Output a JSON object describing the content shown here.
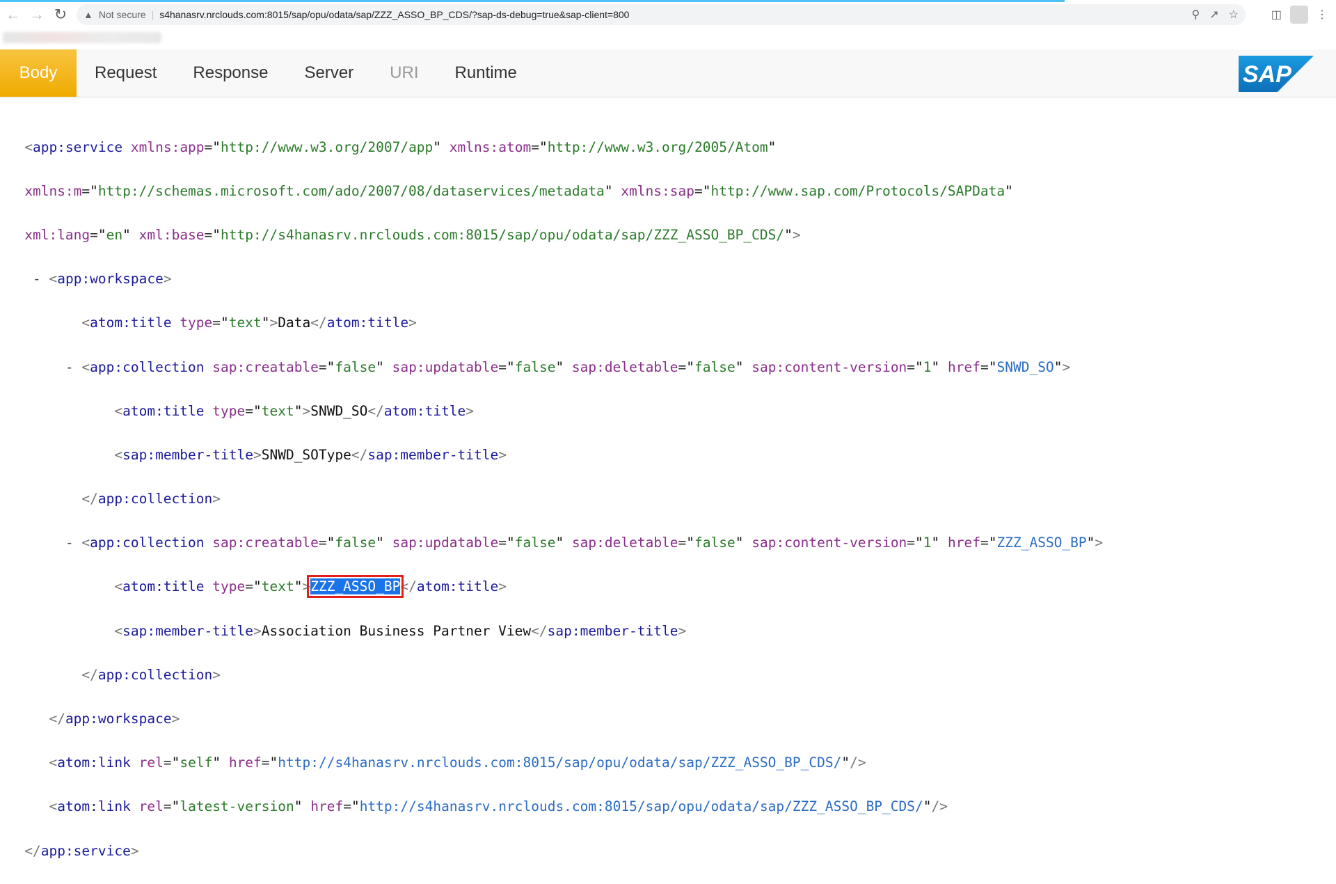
{
  "browser": {
    "security_label": "Not secure",
    "url_host": "s4hanasrv.nrclouds.com",
    "url_rest": ":8015/sap/opu/odata/sap/ZZZ_ASSO_BP_CDS/?sap-ds-debug=true&sap-client=800",
    "icons": [
      "back-icon",
      "forward-icon",
      "reload-icon",
      "warning-icon",
      "zoom-icon",
      "share-icon",
      "bookmark-star-icon",
      "sidepanel-icon",
      "profile-avatar"
    ]
  },
  "tabs": [
    "Body",
    "Request",
    "Response",
    "Server",
    "URI",
    "Runtime"
  ],
  "logo": "SAP",
  "xml": {
    "service_open": "app:service",
    "ns_app": "xmlns:app",
    "ns_app_val": "http://www.w3.org/2007/app",
    "ns_atom": "xmlns:atom",
    "ns_atom_val": "http://www.w3.org/2005/Atom",
    "ns_m": "xmlns:m",
    "ns_m_val": "http://schemas.microsoft.com/ado/2007/08/dataservices/metadata",
    "ns_sap": "xmlns:sap",
    "ns_sap_val": "http://www.sap.com/Protocols/SAPData",
    "xml_lang": "xml:lang",
    "xml_lang_val": "en",
    "xml_base": "xml:base",
    "xml_base_val": "http://s4hanasrv.nrclouds.com:8015/sap/opu/odata/sap/ZZZ_ASSO_BP_CDS/",
    "workspace": "app:workspace",
    "atom_title": "atom:title",
    "type_attr": "type",
    "type_val": "text",
    "ws_title": "Data",
    "collection": "app:collection",
    "creatable": "sap:creatable",
    "updatable": "sap:updatable",
    "deletable": "sap:deletable",
    "false_val": "false",
    "content_version": "sap:content-version",
    "cv_val": "1",
    "href": "href",
    "c1_href": "SNWD_SO",
    "c1_title": "SNWD_SO",
    "member_title": "sap:member-title",
    "c1_member": "SNWD_SOType",
    "c2_href": "ZZZ_ASSO_BP",
    "c2_title": "ZZZ_ASSO_BP",
    "c2_member": "Association Business Partner View",
    "atom_link": "atom:link",
    "rel": "rel",
    "rel_self": "self",
    "rel_latest": "latest-version",
    "link_href": "http://s4hanasrv.nrclouds.com:8015/sap/opu/odata/sap/ZZZ_ASSO_BP_CDS/",
    "toggle": "-"
  }
}
